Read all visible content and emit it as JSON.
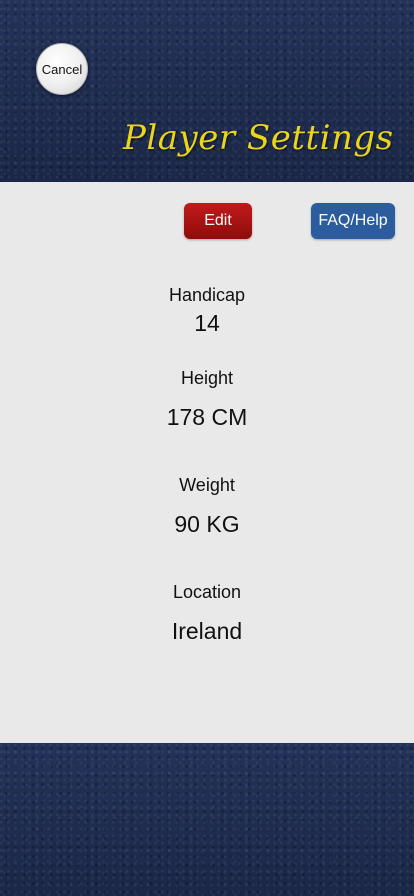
{
  "header": {
    "cancel_label": "Cancel",
    "title": "Player Settings"
  },
  "toolbar": {
    "edit_label": "Edit",
    "faq_label": "FAQ/Help"
  },
  "fields": {
    "handicap": {
      "label": "Handicap",
      "value": "14"
    },
    "height": {
      "label": "Height",
      "value": "178 CM"
    },
    "weight": {
      "label": "Weight",
      "value": "90 KG"
    },
    "location": {
      "label": "Location",
      "value": "Ireland"
    }
  },
  "colors": {
    "felt": "#1f2d52",
    "title": "#e9d51c",
    "panel": "#e9e9e9",
    "edit": "#a81212",
    "faq": "#2b5c9e"
  }
}
